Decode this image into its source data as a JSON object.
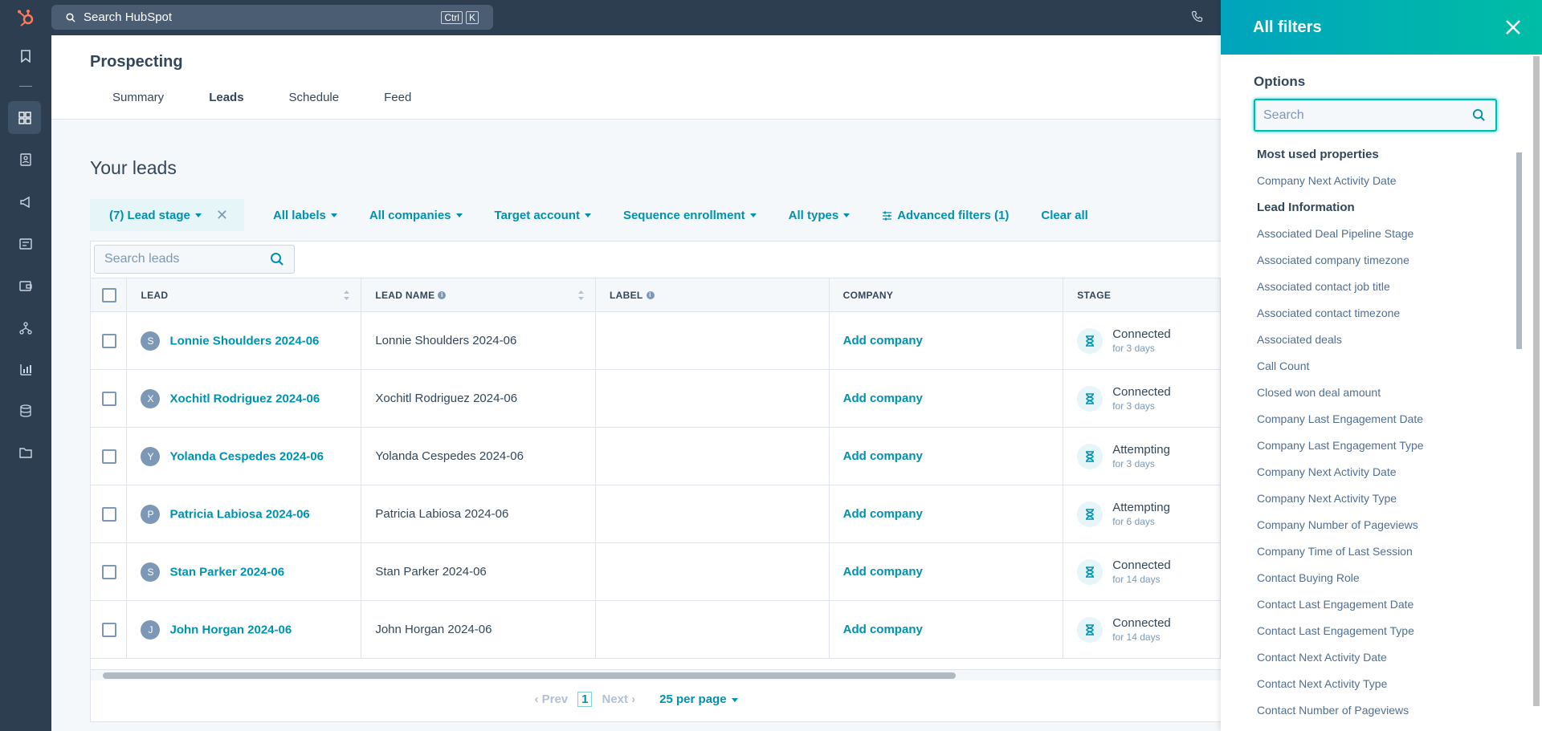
{
  "topbar": {
    "search_label": "Search HubSpot",
    "kbd_ctrl": "Ctrl",
    "kbd_k": "K"
  },
  "page": {
    "title": "Prospecting",
    "tabs": [
      "Summary",
      "Leads",
      "Schedule",
      "Feed"
    ],
    "active_tab": "Leads"
  },
  "leads": {
    "heading": "Your leads",
    "filters": {
      "lead_stage": "(7) Lead stage",
      "labels": "All labels",
      "companies": "All companies",
      "target_account": "Target account",
      "sequence": "Sequence enrollment",
      "types": "All types",
      "advanced": "Advanced filters (1)",
      "clear": "Clear all"
    },
    "search_placeholder": "Search leads",
    "columns": [
      "LEAD",
      "LEAD NAME",
      "LABEL",
      "COMPANY",
      "STAGE"
    ],
    "rows": [
      {
        "initial": "S",
        "lead": "Lonnie Shoulders 2024-06",
        "name": "Lonnie Shoulders 2024-06",
        "company": "Add company",
        "stage": "Connected",
        "duration": "for 3 days"
      },
      {
        "initial": "X",
        "lead": "Xochitl Rodriguez 2024-06",
        "name": "Xochitl Rodriguez 2024-06",
        "company": "Add company",
        "stage": "Connected",
        "duration": "for 3 days"
      },
      {
        "initial": "Y",
        "lead": "Yolanda Cespedes 2024-06",
        "name": "Yolanda Cespedes 2024-06",
        "company": "Add company",
        "stage": "Attempting",
        "duration": "for 3 days"
      },
      {
        "initial": "P",
        "lead": "Patricia Labiosa 2024-06",
        "name": "Patricia Labiosa 2024-06",
        "company": "Add company",
        "stage": "Attempting",
        "duration": "for 6 days"
      },
      {
        "initial": "S",
        "lead": "Stan Parker 2024-06",
        "name": "Stan Parker 2024-06",
        "company": "Add company",
        "stage": "Connected",
        "duration": "for 14 days"
      },
      {
        "initial": "J",
        "lead": "John Horgan 2024-06",
        "name": "John Horgan 2024-06",
        "company": "Add company",
        "stage": "Connected",
        "duration": "for 14 days"
      }
    ],
    "pager": {
      "prev": "Prev",
      "page": "1",
      "next": "Next",
      "per_page": "25 per page"
    }
  },
  "filters_panel": {
    "title": "All filters",
    "options_label": "Options",
    "search_placeholder": "Search",
    "groups": [
      {
        "label": "Most used properties",
        "items": [
          "Company Next Activity Date"
        ]
      },
      {
        "label": "Lead Information",
        "items": [
          "Associated Deal Pipeline Stage",
          "Associated company timezone",
          "Associated contact job title",
          "Associated contact timezone",
          "Associated deals",
          "Call Count",
          "Closed won deal amount",
          "Company Last Engagement Date",
          "Company Last Engagement Type",
          "Company Next Activity Date",
          "Company Next Activity Type",
          "Company Number of Pageviews",
          "Company Time of Last Session",
          "Contact Buying Role",
          "Contact Last Engagement Date",
          "Contact Last Engagement Type",
          "Contact Next Activity Date",
          "Contact Next Activity Type",
          "Contact Number of Pageviews"
        ]
      }
    ]
  },
  "colors": {
    "brand": "#ff7a59",
    "accent": "#0091ae",
    "nav_bg": "#2d3e50",
    "panel_header_start": "#00a4bd",
    "panel_header_end": "#00bda5"
  }
}
